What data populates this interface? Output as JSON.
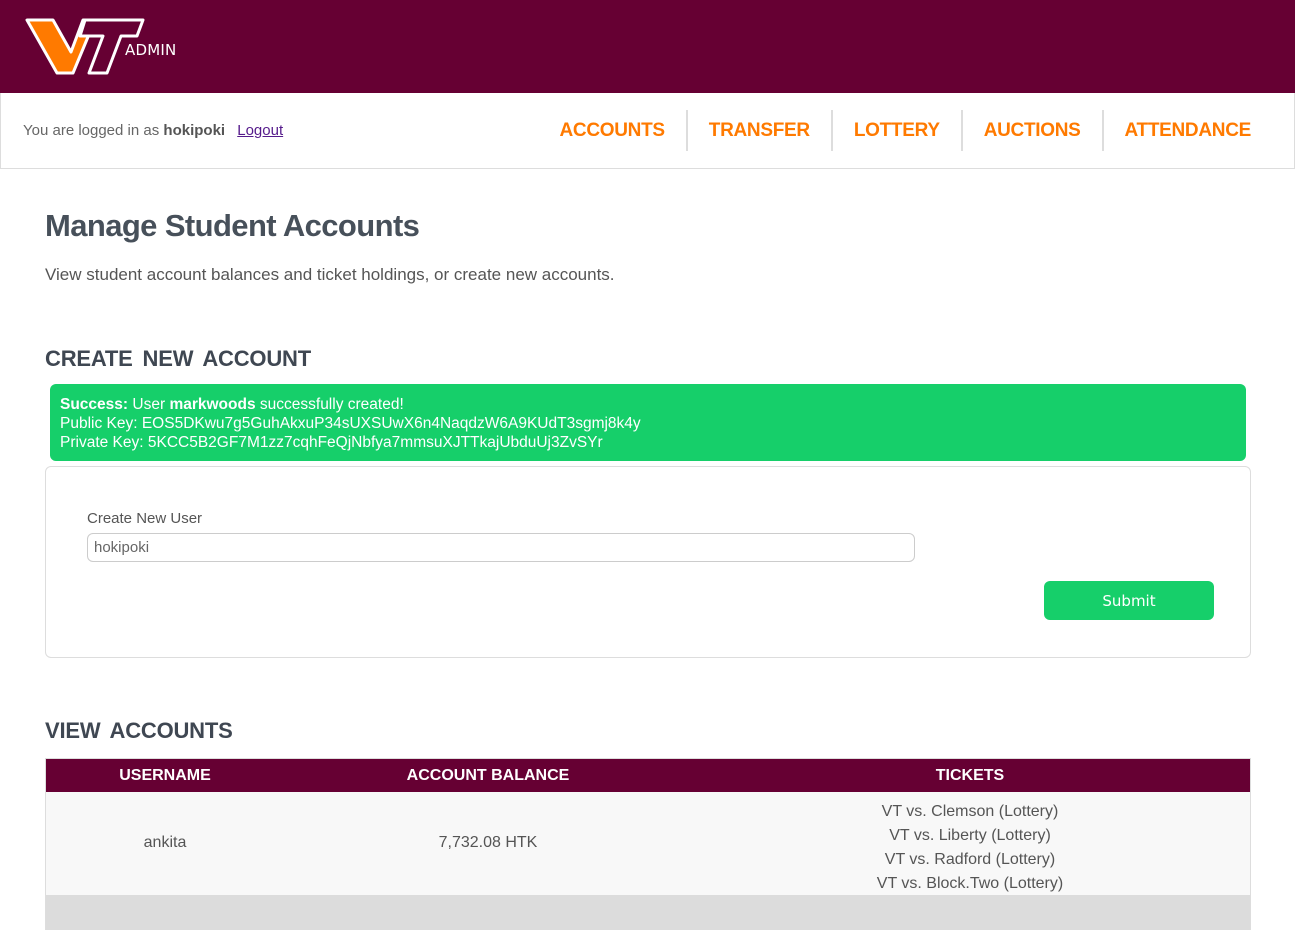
{
  "header": {
    "logo_text": "VT",
    "logo_sub": "ADMIN"
  },
  "nav": {
    "logged_in_prefix": "You are logged in as",
    "username": "hokipoki",
    "logout_label": "Logout",
    "links": [
      "ACCOUNTS",
      "TRANSFER",
      "LOTTERY",
      "AUCTIONS",
      "ATTENDANCE"
    ]
  },
  "page": {
    "title": "Manage Student Accounts",
    "intro": "View student account balances and ticket holdings, or create new accounts."
  },
  "create": {
    "section_title": "CREATE NEW ACCOUNT",
    "alert": {
      "label": "Success:",
      "pre": "User",
      "user": "markwoods",
      "post": "successfully created!",
      "public_key": "Public Key: EOS5DKwu7g5GuhAkxuP34sUXSUwX6n4NaqdzW6A9KUdT3sgmj8k4y",
      "private_key": "Private Key: 5KCC5B2GF7M1zz7cqhFeQjNbfya7mmsuXJTTkajUbduUj3ZvSYr"
    },
    "form": {
      "label": "Create New User",
      "value": "hokipoki",
      "submit": "Submit"
    }
  },
  "view": {
    "section_title": "VIEW ACCOUNTS",
    "headers": [
      "USERNAME",
      "ACCOUNT BALANCE",
      "TICKETS"
    ],
    "rows": [
      {
        "username": "ankita",
        "balance": "7,732.08 HTK",
        "tickets": [
          "VT vs. Clemson (Lottery)",
          "VT vs. Liberty (Lottery)",
          "VT vs. Radford (Lottery)",
          "VT vs. Block.Two (Lottery)"
        ]
      }
    ]
  },
  "colors": {
    "maroon": "#660033",
    "orange": "#ff7a00",
    "green": "#16cf6a"
  }
}
